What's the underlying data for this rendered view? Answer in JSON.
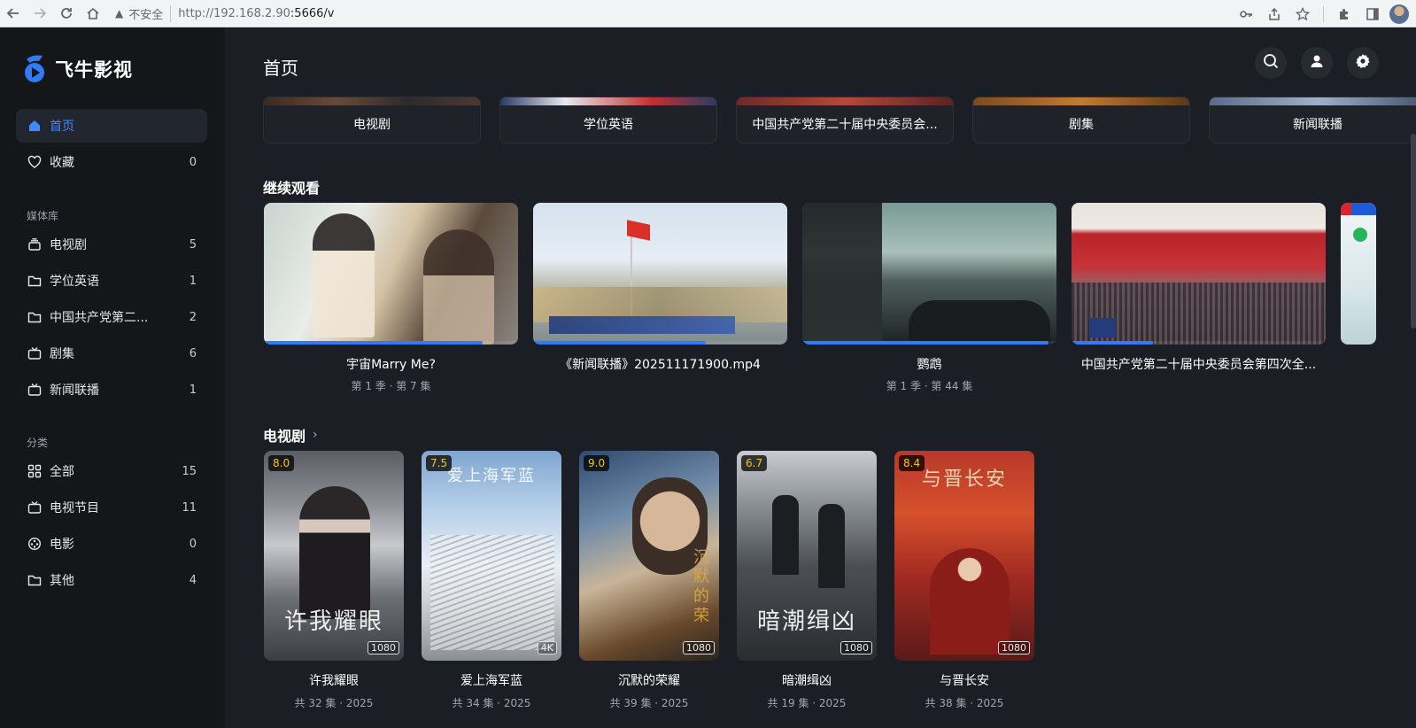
{
  "browser": {
    "insecure_label": "不安全",
    "url_host": "http://192.168.2.90",
    "url_rest": ":5666/v"
  },
  "app": {
    "name": "飞牛影视",
    "page_title": "首页",
    "accent": "#2f7cf6"
  },
  "sidebar": {
    "top_items": [
      {
        "label": "首页",
        "icon": "home-icon",
        "count": ""
      },
      {
        "label": "收藏",
        "icon": "heart-icon",
        "count": "0"
      }
    ],
    "library_heading": "媒体库",
    "library_items": [
      {
        "label": "电视剧",
        "icon": "tv-stack-icon",
        "count": "5"
      },
      {
        "label": "学位英语",
        "icon": "folder-icon",
        "count": "1"
      },
      {
        "label": "中国共产党第二...",
        "icon": "folder-icon",
        "count": "2"
      },
      {
        "label": "剧集",
        "icon": "tv-icon",
        "count": "6"
      },
      {
        "label": "新闻联播",
        "icon": "tv-icon",
        "count": "1"
      }
    ],
    "category_heading": "分类",
    "category_items": [
      {
        "label": "全部",
        "icon": "grid-icon",
        "count": "15"
      },
      {
        "label": "电视节目",
        "icon": "tv-icon",
        "count": "11"
      },
      {
        "label": "电影",
        "icon": "film-reel-icon",
        "count": "0"
      },
      {
        "label": "其他",
        "icon": "folder-icon",
        "count": "4"
      }
    ]
  },
  "libraries": [
    "电视剧",
    "学位英语",
    "中国共产党第二十届中央委员会...",
    "剧集",
    "新闻联播"
  ],
  "continue_watching": {
    "heading": "继续观看",
    "items": [
      {
        "title": "宇宙Marry Me?",
        "subtitle": "第 1 季 · 第 7 集",
        "progress": 0.86
      },
      {
        "title": "《新闻联播》202511171900.mp4",
        "subtitle": "",
        "progress": 0.68
      },
      {
        "title": "鹦鹉",
        "subtitle": "第 1 季 · 第 44 集",
        "progress": 0.97
      },
      {
        "title": "中国共产党第二十届中央委员会第四次全...",
        "subtitle": "",
        "progress": 0.32
      }
    ]
  },
  "tv_section": {
    "heading": "电视剧",
    "items": [
      {
        "title": "许我耀眼",
        "meta": "共 32 集 · 2025",
        "rating": "8.0",
        "quality": "1080",
        "poster_text": "许我耀眼"
      },
      {
        "title": "爱上海军蓝",
        "meta": "共 34 集 · 2025",
        "rating": "7.5",
        "quality": "4K",
        "poster_text": "爱上海军蓝"
      },
      {
        "title": "沉默的荣耀",
        "meta": "共 39 集 · 2025",
        "rating": "9.0",
        "quality": "1080",
        "poster_text": "沉默的荣"
      },
      {
        "title": "暗潮缉凶",
        "meta": "共 19 集 · 2025",
        "rating": "6.7",
        "quality": "1080",
        "poster_text": "暗潮缉凶"
      },
      {
        "title": "与晋长安",
        "meta": "共 38 集 · 2025",
        "rating": "8.4",
        "quality": "1080",
        "poster_text": "与晋长安"
      }
    ]
  }
}
